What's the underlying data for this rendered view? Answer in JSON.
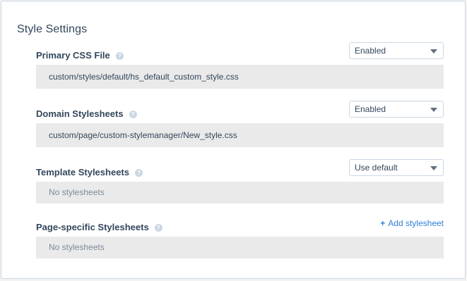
{
  "panel": {
    "title": "Style Settings"
  },
  "sections": [
    {
      "label": "Primary CSS File",
      "help": "?",
      "select_value": "Enabled",
      "value": "custom/styles/default/hs_default_custom_style.css"
    },
    {
      "label": "Domain Stylesheets",
      "help": "?",
      "select_value": "Enabled",
      "value": "custom/page/custom-stylemanager/New_style.css"
    },
    {
      "label": "Template Stylesheets",
      "help": "?",
      "select_value": "Use default",
      "value": "No stylesheets"
    },
    {
      "label": "Page-specific Stylesheets",
      "help": "?",
      "action_icon": "+",
      "action_label": "Add stylesheet",
      "value": "No stylesheets"
    }
  ],
  "colors": {
    "accent": "#2f7fd6",
    "text": "#33475b",
    "box_bg": "#eaeaea"
  }
}
